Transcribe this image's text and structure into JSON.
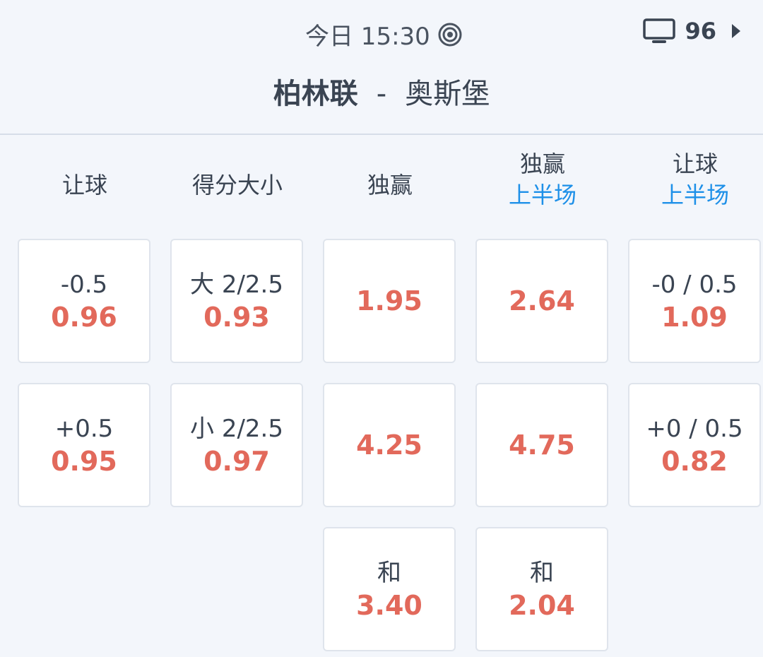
{
  "status": {
    "time": "今日 15:30",
    "tv_count": "96"
  },
  "match": {
    "home": "柏林联",
    "separator": "-",
    "away": "奥斯堡"
  },
  "headers": [
    {
      "title": "让球",
      "sub": ""
    },
    {
      "title": "得分大小",
      "sub": ""
    },
    {
      "title": "独赢",
      "sub": ""
    },
    {
      "title": "独赢",
      "sub": "上半场"
    },
    {
      "title": "让球",
      "sub": "上半场"
    }
  ],
  "markets": {
    "handicap": [
      {
        "line": "-0.5",
        "odd": "0.96"
      },
      {
        "line": "+0.5",
        "odd": "0.95"
      }
    ],
    "totals": [
      {
        "line": "大 2/2.5",
        "odd": "0.93"
      },
      {
        "line": "小 2/2.5",
        "odd": "0.97"
      }
    ],
    "moneyline": [
      {
        "line": "",
        "odd": "1.95"
      },
      {
        "line": "",
        "odd": "4.25"
      },
      {
        "line": "和",
        "odd": "3.40"
      }
    ],
    "moneyline_1h": [
      {
        "line": "",
        "odd": "2.64"
      },
      {
        "line": "",
        "odd": "4.75"
      },
      {
        "line": "和",
        "odd": "2.04"
      }
    ],
    "handicap_1h": [
      {
        "line": "-0 / 0.5",
        "odd": "1.09"
      },
      {
        "line": "+0 / 0.5",
        "odd": "0.82"
      }
    ]
  },
  "icons": {
    "live": "live-stream-icon",
    "tv": "tv-icon",
    "next": "chevron-right-icon"
  },
  "colors": {
    "odd": "#e2695b",
    "accent": "#1e90e8",
    "background": "#f3f6fb"
  }
}
